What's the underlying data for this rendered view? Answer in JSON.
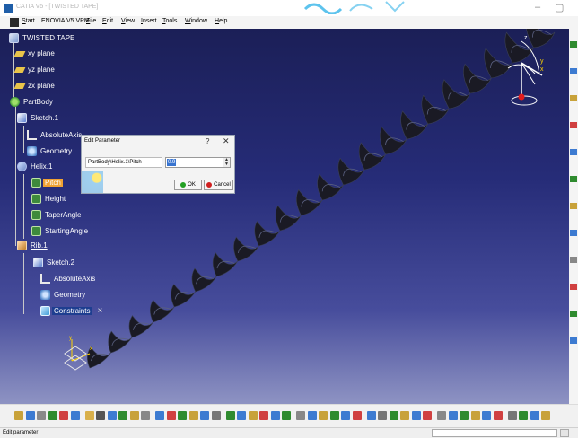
{
  "window": {
    "title": "CATIA V5 - [TWISTED TAPE]",
    "minimize_glyph": "–",
    "maximize_glyph": "▢",
    "close_glyph": "×"
  },
  "menu": {
    "items": [
      {
        "label": "Start",
        "accel": "S",
        "rest": "tart"
      },
      {
        "label": "ENOVIA V5 VPM",
        "accel": "",
        "rest": "ENOVIA V5 VPM"
      },
      {
        "label": "File",
        "accel": "F",
        "rest": "ile"
      },
      {
        "label": "Edit",
        "accel": "E",
        "rest": "dit"
      },
      {
        "label": "View",
        "accel": "V",
        "rest": "iew"
      },
      {
        "label": "Insert",
        "accel": "I",
        "rest": "nsert"
      },
      {
        "label": "Tools",
        "accel": "T",
        "rest": "ools"
      },
      {
        "label": "Window",
        "accel": "W",
        "rest": "indow"
      },
      {
        "label": "Help",
        "accel": "H",
        "rest": "elp"
      }
    ]
  },
  "tree": {
    "root": "TWISTED TAPE",
    "xy_plane": "xy plane",
    "yz_plane": "yz plane",
    "zx_plane": "zx plane",
    "part_body": "PartBody",
    "sketch1": "Sketch.1",
    "absolute_axis1": "AbsoluteAxis",
    "geometry1": "Geometry",
    "helix1": "Helix.1",
    "pitch": "Pitch",
    "height": "Height",
    "taper_angle": "TaperAngle",
    "starting_angle": "StartingAngle",
    "rib1": "Rib.1",
    "sketch2": "Sketch.2",
    "absolute_axis2": "AbsoluteAxis",
    "geometry2": "Geometry",
    "constraints": "Constraints",
    "constraints_close": "×",
    "selected_item": "pitch"
  },
  "dialog": {
    "title": "Edit Parameter",
    "help_glyph": "?",
    "close_glyph": "✕",
    "parameter_path": "PartBody\\Helix.1\\Pitch",
    "value": "0.9",
    "spin_up": "▲",
    "spin_down": "▼",
    "ok_label": "OK",
    "cancel_label": "Cancel"
  },
  "compass": {
    "z_label": "z",
    "y_label": "y",
    "x_label": "x"
  },
  "axis_triad": {
    "y_label": "y",
    "x_label": "x"
  },
  "status": {
    "text": "Edit parameter"
  },
  "colors": {
    "viewport_top": "#1b1f57",
    "viewport_bottom": "#8e93c3",
    "highlight": "#f0a233",
    "tape": "#1a1a24"
  }
}
